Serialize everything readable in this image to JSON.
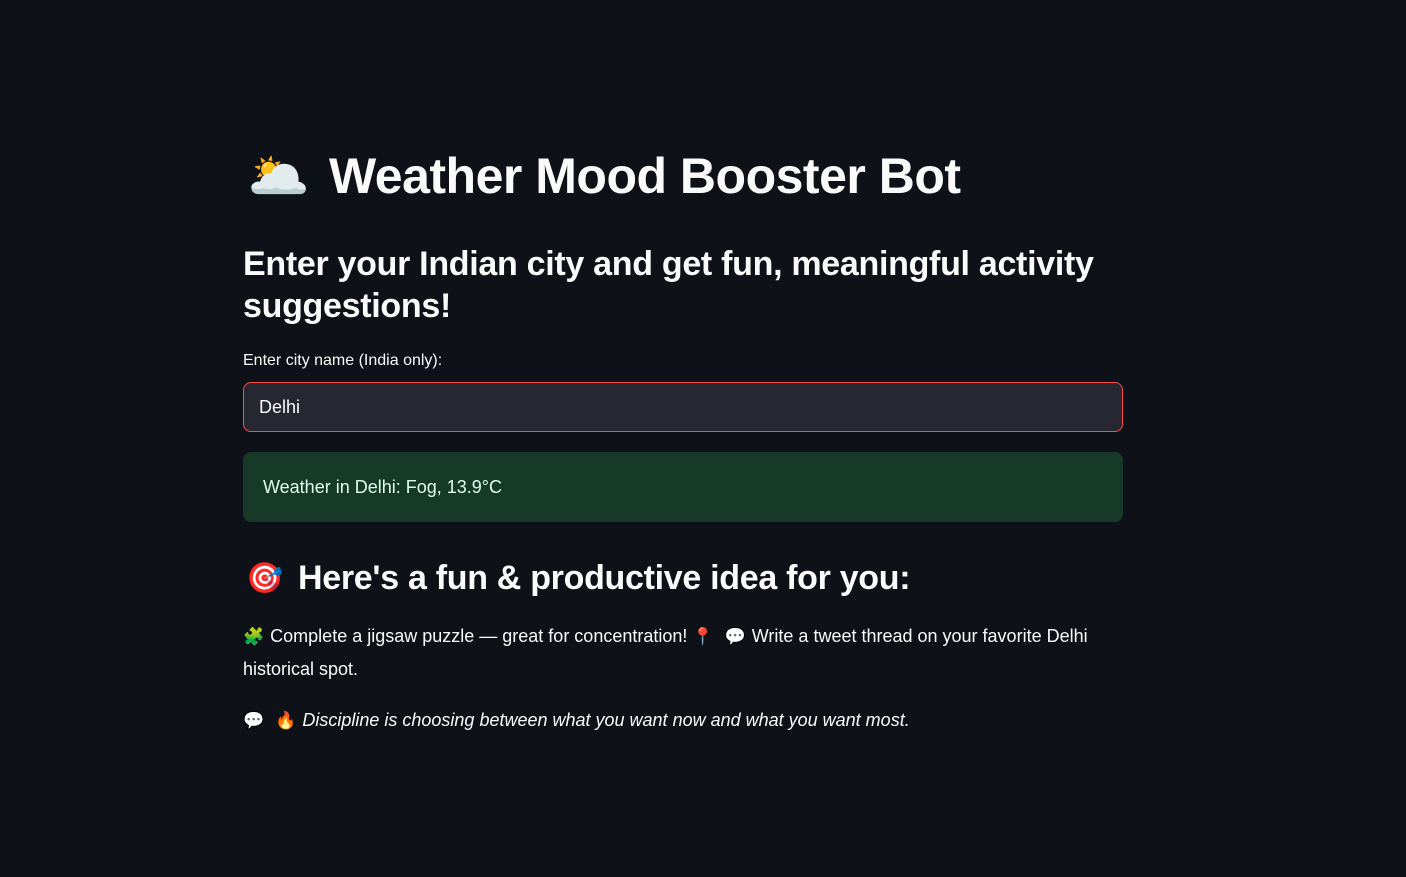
{
  "app": {
    "title_emoji": "🌥️",
    "title": "Weather Mood Booster Bot",
    "subtitle": "Enter your Indian city and get fun, meaningful activity suggestions!"
  },
  "city_input": {
    "label": "Enter city name (India only):",
    "value": "Delhi"
  },
  "weather_result": {
    "text": "Weather in Delhi: Fog, 13.9°C"
  },
  "idea_section": {
    "emoji": "🎯",
    "heading": "Here's a fun & productive idea for you:",
    "suggestion_part1_icon": "🧩",
    "suggestion_part1": "Complete a jigsaw puzzle — great for concentration!",
    "pin_icon": "📍",
    "speech_icon": "💬",
    "suggestion_part2": "Write a tweet thread on your favorite Delhi historical spot.",
    "quote_icon": "💬",
    "fire_icon": "🔥",
    "quote": "Discipline is choosing between what you want now and what you want most."
  },
  "colors": {
    "background": "#0e1117",
    "input_background": "#262730",
    "input_border_focus": "#ff4b4b",
    "success_background": "#173928",
    "success_text": "#dffde9"
  }
}
